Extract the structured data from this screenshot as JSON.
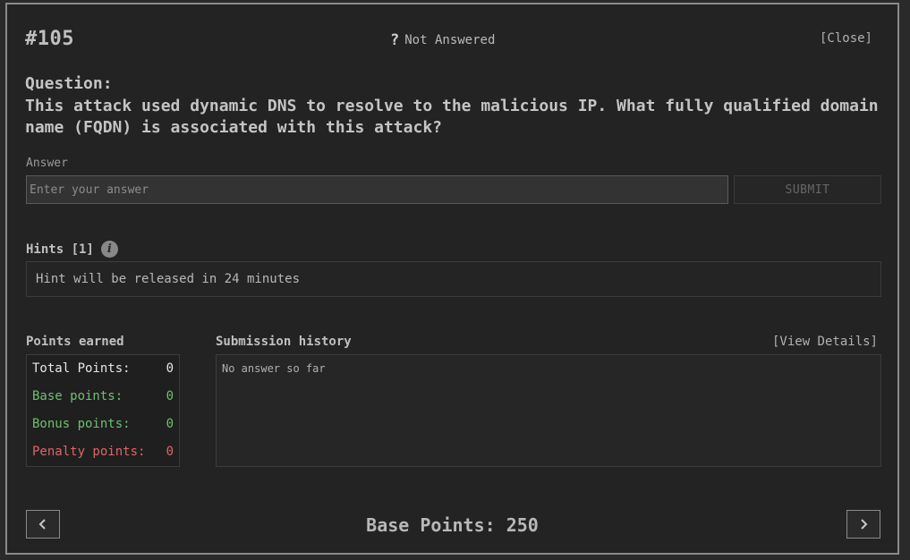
{
  "question": {
    "id": "#105",
    "status_icon": "?",
    "status": "Not Answered",
    "close_label": "[Close]",
    "label": "Question:",
    "text": "This attack used dynamic DNS to resolve to the malicious IP. What fully qualified domain name (FQDN) is associated with this attack?"
  },
  "answer": {
    "label": "Answer",
    "placeholder": "Enter your answer",
    "value": "",
    "submit_label": "SUBMIT"
  },
  "hints": {
    "label": "Hints [1]",
    "info_icon": "i",
    "text": "Hint will be released in 24 minutes"
  },
  "points": {
    "label": "Points earned",
    "rows": [
      {
        "label": "Total Points:",
        "value": "0"
      },
      {
        "label": "Base points:",
        "value": "0"
      },
      {
        "label": "Bonus points:",
        "value": "0"
      },
      {
        "label": "Penalty points:",
        "value": "0"
      }
    ],
    "colors": {
      "total": "#e6e6e6",
      "base": "#6fbf6f",
      "bonus": "#6fbf6f",
      "penalty": "#e06464"
    }
  },
  "history": {
    "label": "Submission history",
    "view_details_label": "[View Details]",
    "text": "No answer so far"
  },
  "footer": {
    "base_points": "Base Points: 250",
    "prev_icon": "chevron-left-icon",
    "next_icon": "chevron-right-icon"
  },
  "theme": {
    "background": "#232323",
    "border": "#8a8a8a"
  }
}
